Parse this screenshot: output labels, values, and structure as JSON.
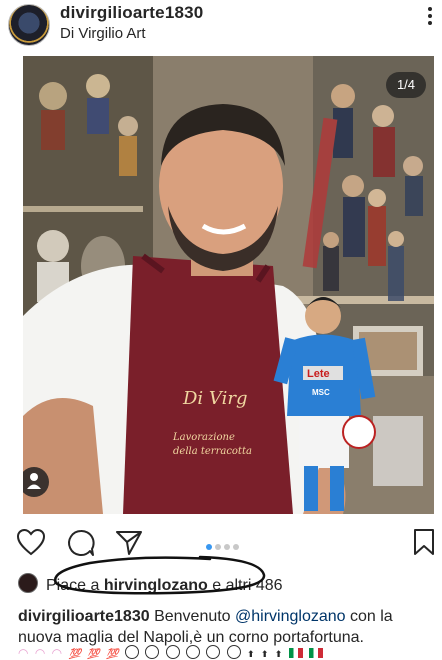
{
  "post": {
    "username": "divirgilioarte1830",
    "subtitle": "Di Virgilio Art",
    "image_counter": "1/4",
    "likes": {
      "prefix": "Piace a ",
      "user": "hirvinglozano",
      "suffix": " e altri 486"
    },
    "caption": {
      "username": "divirgilioarte1830",
      "text1": " Benvenuto ",
      "mention": "@hirvinglozano",
      "text2": " con la nuova maglia del Napoli,è un corno portafortuna."
    },
    "carousel": {
      "total": 4,
      "active": 1
    }
  },
  "photo_text": {
    "apron_brand": "Di Virg",
    "apron_line1": "Lavorazione",
    "apron_line2": "della terracotta",
    "jersey_sponsor1": "Lete",
    "jersey_sponsor2": "MSC"
  },
  "colors": {
    "annotation": "#111111",
    "active_dot": "#3897f0",
    "apron": "#7a1f2a",
    "jersey": "#2a7fd4"
  }
}
